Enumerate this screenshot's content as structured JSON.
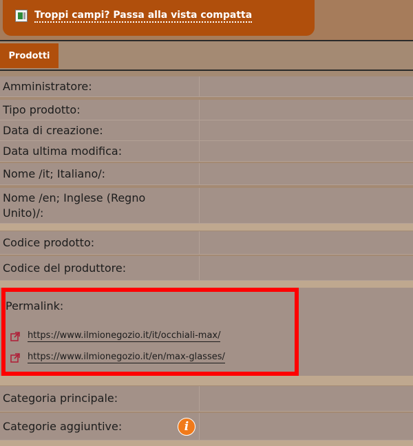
{
  "banner": {
    "compact_view_link": "Troppi campi? Passa alla vista compatta"
  },
  "tabs": [
    {
      "label": "Prodotti",
      "active": true
    }
  ],
  "fields": {
    "amministratore": "Amministratore:",
    "tipo_prodotto": "Tipo prodotto:",
    "data_creazione": "Data di creazione:",
    "data_ultima_modifica": "Data ultima modifica:",
    "nome_it": "Nome /it; Italiano/:",
    "nome_en": "Nome /en; Inglese (Regno Unito)/:",
    "codice_prodotto": "Codice prodotto:",
    "codice_produttore": "Codice del produttore:",
    "permalink": "Permalink:",
    "categoria_principale": "Categoria principale:",
    "categorie_aggiuntive": "Categorie aggiuntive:"
  },
  "permalinks": [
    {
      "url": "https://www.ilmionegozio.it/it/occhiali-max/",
      "icon": "external-link-icon"
    },
    {
      "url": "https://www.ilmionegozio.it/en/max-glasses/",
      "icon": "external-link-icon"
    }
  ],
  "colors": {
    "accent": "#b04f0c",
    "highlight": "#ff0000",
    "info": "#f07a1a"
  }
}
